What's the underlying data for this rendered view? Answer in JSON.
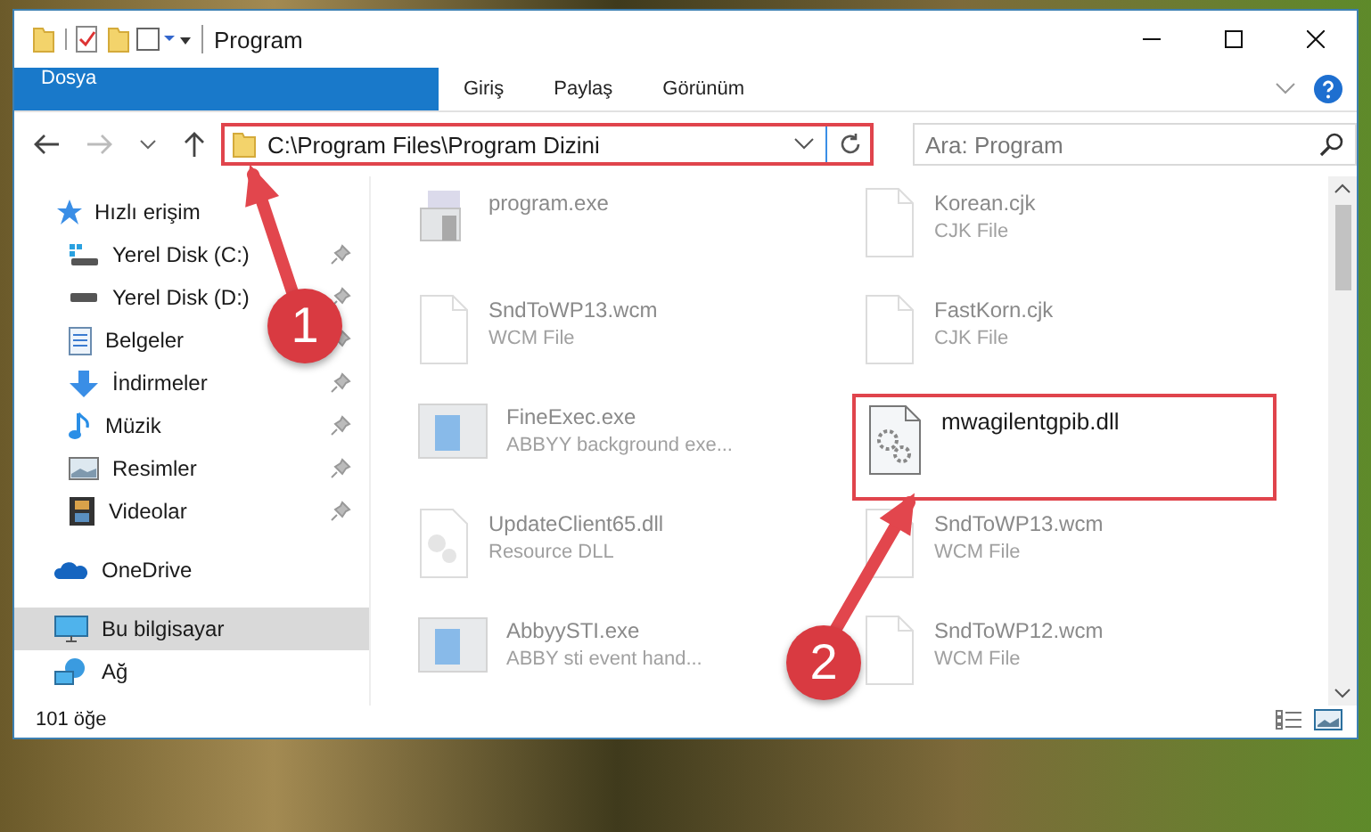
{
  "window": {
    "title": "Program"
  },
  "ribbon_tabs": [
    {
      "label": "Dosya",
      "kind": "file-menu"
    },
    {
      "label": "Giriş",
      "kind": "tab"
    },
    {
      "label": "Paylaş",
      "kind": "tab"
    },
    {
      "label": "Görünüm",
      "kind": "tab"
    }
  ],
  "address_bar": {
    "path": "C:\\Program Files\\Program Dizini",
    "highlighted": true
  },
  "search": {
    "placeholder": "Ara: Program"
  },
  "sidebar": {
    "items": [
      {
        "label": "Hızlı erişim",
        "kind": "star",
        "selected": false,
        "children": [
          {
            "label": "Yerel Disk (C:)",
            "kind": "system-drive",
            "pinned": true,
            "selected": false
          },
          {
            "label": "Yerel Disk (D:)",
            "kind": "drive",
            "pinned": true,
            "selected": false
          },
          {
            "label": "Belgeler",
            "kind": "documents",
            "pinned": true,
            "selected": false
          },
          {
            "label": "İndirmeler",
            "kind": "downloads",
            "pinned": true,
            "selected": false
          },
          {
            "label": "Müzik",
            "kind": "music",
            "pinned": true,
            "selected": false
          },
          {
            "label": "Resimler",
            "kind": "pictures",
            "pinned": true,
            "selected": false
          },
          {
            "label": "Videolar",
            "kind": "videos",
            "pinned": true,
            "selected": false
          }
        ]
      },
      {
        "label": "OneDrive",
        "kind": "cloud",
        "selected": false
      },
      {
        "label": "Bu bilgisayar",
        "kind": "computer",
        "selected": true
      },
      {
        "label": "Ağ",
        "kind": "network",
        "selected": false
      }
    ]
  },
  "files": [
    {
      "name": "program.exe",
      "kind": "installer",
      "dimmed": true,
      "highlighted": false
    },
    {
      "name": "Korean.cjk",
      "type": "CJK File",
      "kind": "blank",
      "dimmed": true,
      "highlighted": false
    },
    {
      "name": "SndToWP13.wcm",
      "type": "WCM File",
      "kind": "blank",
      "dimmed": true,
      "highlighted": false
    },
    {
      "name": "FastKorn.cjk",
      "type": "CJK File",
      "kind": "blank",
      "dimmed": true,
      "highlighted": false
    },
    {
      "name": "FineExec.exe",
      "type": "ABBYY background exe...",
      "kind": "app",
      "dimmed": true,
      "highlighted": false
    },
    {
      "name": "mwagilentgpib.dll",
      "kind": "gears",
      "dimmed": false,
      "highlighted": true
    },
    {
      "name": "UpdateClient65.dll",
      "type": "Resource DLL",
      "kind": "dll",
      "dimmed": true,
      "highlighted": false
    },
    {
      "name": "SndToWP13.wcm",
      "type": "WCM File",
      "kind": "blank",
      "dimmed": true,
      "highlighted": false
    },
    {
      "name": "AbbyySTI.exe",
      "type": "ABBY sti event hand...",
      "kind": "app",
      "dimmed": true,
      "highlighted": false
    },
    {
      "name": "SndToWP12.wcm",
      "type": "WCM File",
      "kind": "blank",
      "dimmed": true,
      "highlighted": false
    }
  ],
  "status_bar": {
    "count": "101 öğe"
  },
  "annotations": [
    {
      "number": "1"
    },
    {
      "number": "2"
    }
  ]
}
